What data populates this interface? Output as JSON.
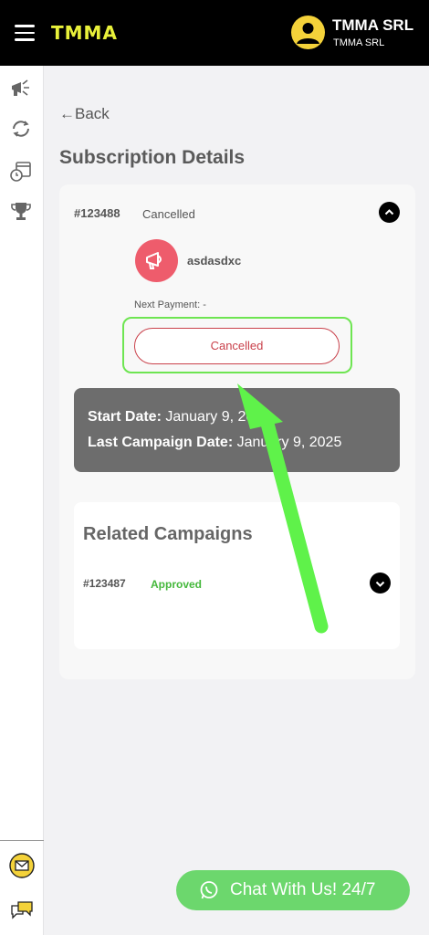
{
  "header": {
    "brand": "TMMA",
    "user_name": "TMMA SRL",
    "user_sub": "TMMA SRL"
  },
  "sidebar": {
    "items": [
      {
        "icon": "megaphone-icon"
      },
      {
        "icon": "refresh-icon"
      },
      {
        "icon": "calendar-clock-icon"
      },
      {
        "icon": "trophy-icon"
      }
    ],
    "bottom": [
      {
        "icon": "mail-icon"
      },
      {
        "icon": "chat-bubbles-icon"
      }
    ]
  },
  "nav": {
    "back_label": "Back"
  },
  "page": {
    "title": "Subscription Details"
  },
  "subscription": {
    "id": "#123488",
    "status": "Cancelled",
    "campaign_name": "asdasdxc",
    "next_payment": "Next Payment: -",
    "action_label": "Cancelled",
    "start_date_label": "Start Date:",
    "start_date": "January 9, 2025",
    "last_campaign_label": "Last Campaign Date:",
    "last_campaign_date": "January 9, 2025"
  },
  "related": {
    "title": "Related Campaigns",
    "items": [
      {
        "id": "#123487",
        "status": "Approved"
      }
    ]
  },
  "chat": {
    "label": "Chat With Us! 24/7"
  },
  "colors": {
    "header_bg": "#000000",
    "brand": "#e8f03a",
    "cancelled": "#c9414b",
    "approved": "#45b83c",
    "chat_bg": "#6cd76d",
    "annotation": "#5ff24a"
  }
}
